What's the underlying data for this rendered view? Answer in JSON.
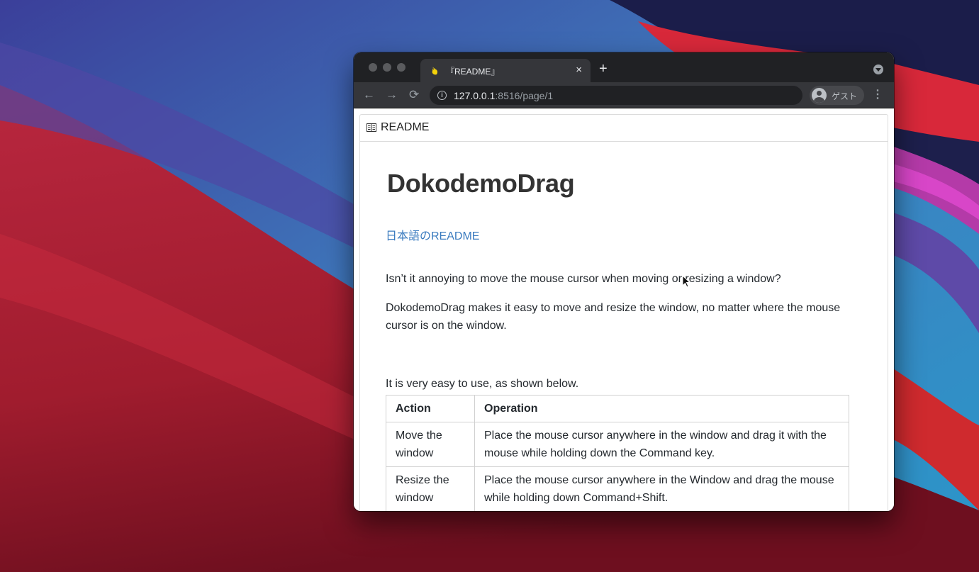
{
  "browser": {
    "tab_title": "『README』",
    "tab_close": "×",
    "new_tab": "+",
    "back": "←",
    "forward": "→",
    "reload": "⟳",
    "url_host": "127.0.0.1",
    "url_rest": ":8516/page/1",
    "profile_label": "ゲスト",
    "menu": "⋮",
    "icons": [
      "info-icon",
      "avatar-icon",
      "book-icon"
    ]
  },
  "readme": {
    "header_title": "README",
    "h1": "DokodemoDrag",
    "lang_link": "日本語のREADME",
    "para1": "Isn’t it annoying to move the mouse cursor when moving or resizing a window?",
    "para2": "DokodemoDrag makes it easy to move and resize the window, no matter where the mouse cursor is on the window.",
    "para3": "It is very easy to use, as shown below.",
    "table": {
      "headers": [
        "Action",
        "Operation"
      ],
      "rows": [
        [
          "Move the window",
          "Place the mouse cursor anywhere in the window and drag it with the mouse while holding down the Command key."
        ],
        [
          "Resize the window",
          "Place the mouse cursor anywhere in the Window and drag the mouse while holding down Command+Shift."
        ]
      ]
    }
  }
}
